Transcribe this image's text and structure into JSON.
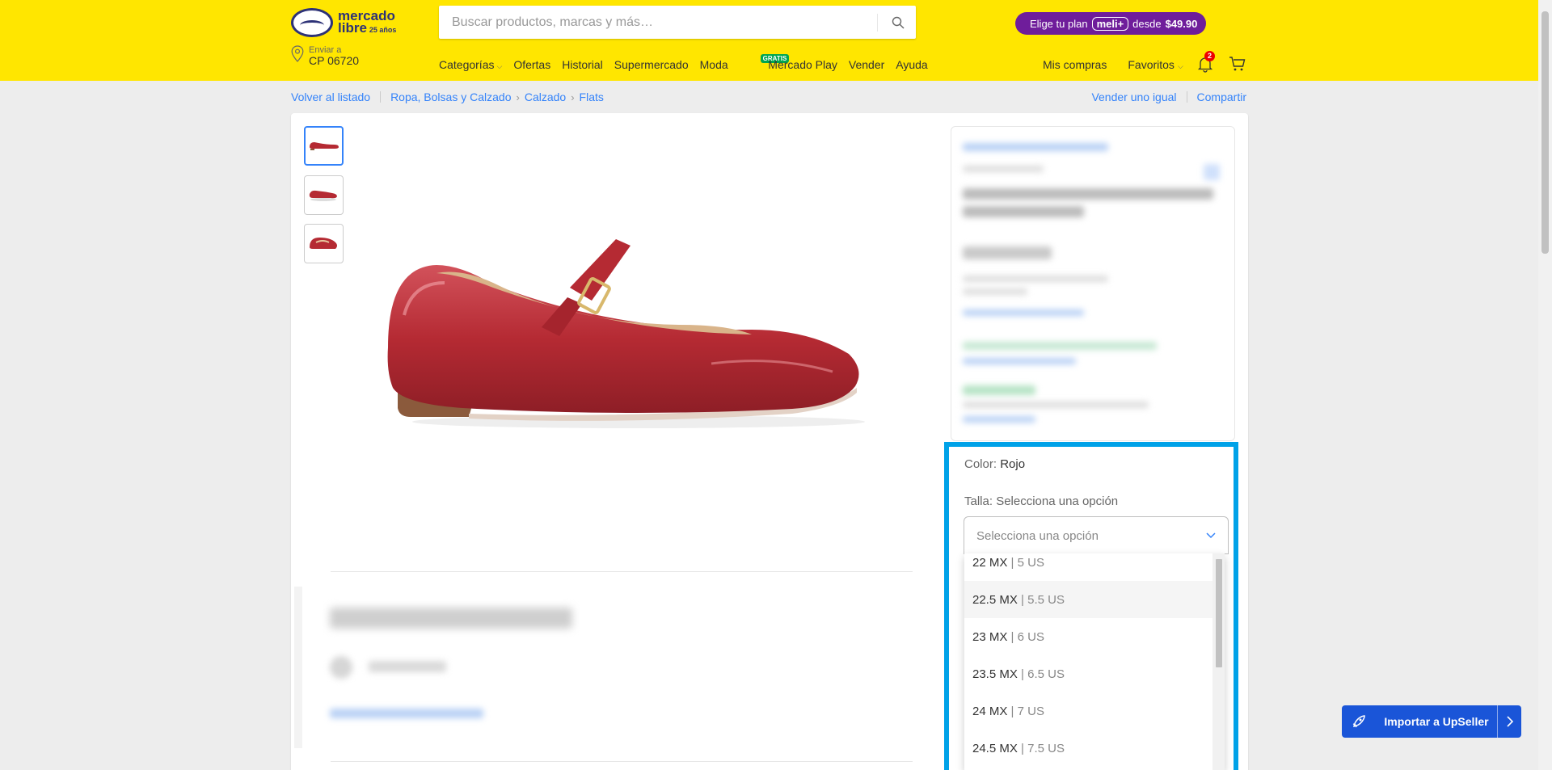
{
  "header": {
    "logo_line1": "mercado",
    "logo_line2": "libre",
    "logo_badge": "25 años",
    "search_placeholder": "Buscar productos, marcas y más…",
    "promo": {
      "prefix": "Elige tu plan",
      "brand": "meli+",
      "middle": "desde",
      "price": "$49.90"
    },
    "ship_label": "Enviar a",
    "ship_cp": "CP 06720",
    "nav": {
      "categorias": "Categorías",
      "ofertas": "Ofertas",
      "historial": "Historial",
      "supermercado": "Supermercado",
      "moda": "Moda",
      "mercado_play": "Mercado Play",
      "mercado_play_badge": "GRATIS",
      "vender": "Vender",
      "ayuda": "Ayuda"
    },
    "mis_compras": "Mis compras",
    "favoritos": "Favoritos",
    "notifications_count": "2"
  },
  "breadcrumb": {
    "back": "Volver al listado",
    "items": [
      "Ropa, Bolsas y Calzado",
      "Calzado",
      "Flats"
    ]
  },
  "actions": {
    "sell_same": "Vender uno igual",
    "share": "Compartir"
  },
  "variation": {
    "color_label": "Color:",
    "color_value": "Rojo",
    "size_label": "Talla:",
    "size_value": "Selecciona una opción",
    "select_value": "Selecciona una opción",
    "options": [
      {
        "mx": "22 MX",
        "us": "| 5 US"
      },
      {
        "mx": "22.5 MX",
        "us": "| 5.5 US"
      },
      {
        "mx": "23 MX",
        "us": "| 6 US"
      },
      {
        "mx": "23.5 MX",
        "us": "| 6.5 US"
      },
      {
        "mx": "24 MX",
        "us": "| 7 US"
      },
      {
        "mx": "24.5 MX",
        "us": "| 7.5 US"
      }
    ]
  },
  "upseller": {
    "label": "Importar a UpSeller"
  },
  "colors": {
    "brand_yellow": "#ffe600",
    "link_blue": "#3483fa",
    "highlight": "#00a2e8",
    "upseller_blue": "#1a55d8",
    "product_red": "#b52a33"
  }
}
